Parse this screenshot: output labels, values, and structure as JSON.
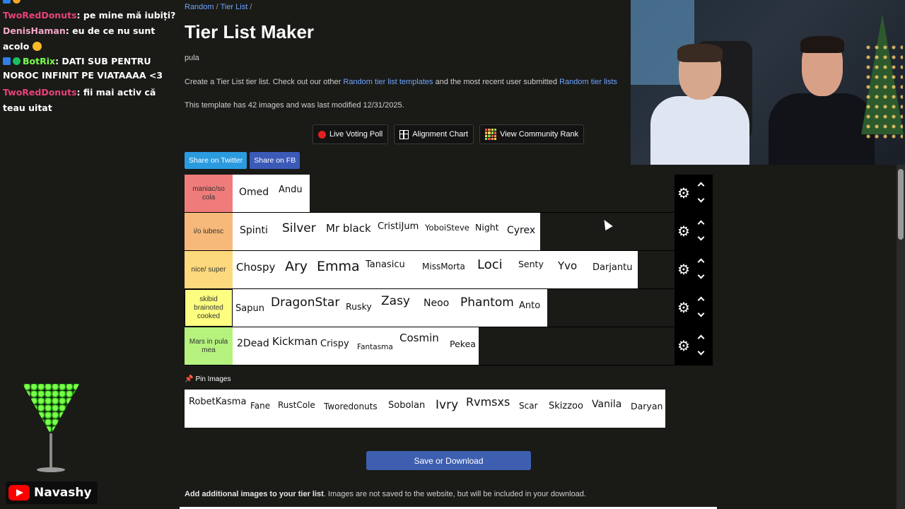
{
  "chat": {
    "messages": [
      {
        "user": "TwoRedDonuts",
        "text": ": pe mine mă iubiți?"
      },
      {
        "user": "DenisHaman",
        "text": ": eu de ce nu sunt acolo"
      },
      {
        "user": "BotRix",
        "text": ": DATI SUB PENTRU NOROC INFINIT PE VIATAAAA <3"
      },
      {
        "user": "TwoRedDonuts",
        "text": ": fii mai activ că teau uitat"
      }
    ]
  },
  "breadcrumb": {
    "random": "Random",
    "tier_list": "Tier List",
    "sep": "/"
  },
  "page_title": "Tier List Maker",
  "subtitle": "pula",
  "description": {
    "prefix": "Create a Tier List tier list. Check out our other ",
    "link1": "Random tier list templates",
    "middle": " and the most recent user submitted ",
    "link2": "Random tier lists"
  },
  "meta": "This template has 42 images and was last modified 12/31/2025.",
  "tools": {
    "live_voting": "Live Voting Poll",
    "alignment": "Alignment Chart",
    "community": "View Community Rank"
  },
  "share": {
    "twitter": "Share on Twitter",
    "fb": "Share on FB"
  },
  "tiers": [
    {
      "label": "maniac/so cola",
      "color": "#f07b7b",
      "items": [
        "Omed",
        "Andu"
      ]
    },
    {
      "label": "i/o iubesc",
      "color": "#f6b97a",
      "items": [
        "Spinti",
        "Silver",
        "Mr black",
        "CristiJum",
        "YoboiSteve",
        "Night",
        "Cyrex"
      ]
    },
    {
      "label": "nice/ super",
      "color": "#fbd97c",
      "items": [
        "Chospy",
        "Ary",
        "Emma",
        "Tanasicu",
        "MissMorta",
        "Loci",
        "Senty",
        "Yvo",
        "Darjantu"
      ]
    },
    {
      "label": "skibid brainoted cooked",
      "color": "#fdfd80",
      "items": [
        "Sapun",
        "DragonStar",
        "Rusky",
        "Zasy",
        "Neoo",
        "Phantom",
        "Anto"
      ]
    },
    {
      "label": "Mars in pula mea",
      "color": "#b5f27e",
      "items": [
        "2Dead",
        "Kickman",
        "Crispy",
        "Fantasma",
        "Cosmin",
        "Pekea"
      ]
    }
  ],
  "pin_label": "Pin Images",
  "pinned": [
    "RobetKasma",
    "Fane",
    "RustCole",
    "Tworedonuts",
    "Sobolan",
    "Ivry",
    "Rvmsxs",
    "Scar",
    "Skizzoo",
    "Vanila",
    "Daryan"
  ],
  "save_button": "Save or Download",
  "add_images": {
    "bold": "Add additional images to your tier list",
    "rest": ". Images are not saved to the website, but will be included in your download."
  },
  "stream": {
    "channel": "Navashy"
  }
}
